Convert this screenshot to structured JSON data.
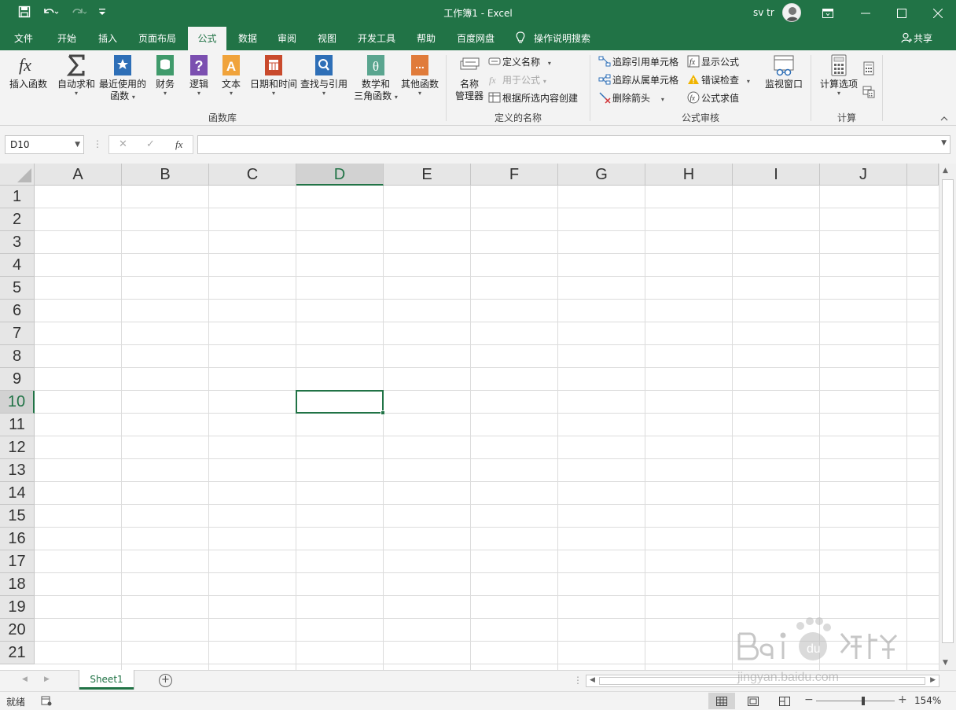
{
  "title_bar": {
    "title": "工作簿1  -  Excel",
    "user": "sv tr",
    "save_icon": "save-icon",
    "undo_icon": "undo-icon",
    "redo_icon": "redo-icon",
    "customize_icon": "customize-qat-icon"
  },
  "tabs": [
    {
      "label": "文件",
      "active": false
    },
    {
      "label": "开始",
      "active": false
    },
    {
      "label": "插入",
      "active": false
    },
    {
      "label": "页面布局",
      "active": false
    },
    {
      "label": "公式",
      "active": true
    },
    {
      "label": "数据",
      "active": false
    },
    {
      "label": "审阅",
      "active": false
    },
    {
      "label": "视图",
      "active": false
    },
    {
      "label": "开发工具",
      "active": false
    },
    {
      "label": "帮助",
      "active": false
    },
    {
      "label": "百度网盘",
      "active": false
    }
  ],
  "tell_me": "操作说明搜索",
  "share": "共享",
  "ribbon": {
    "function_library": {
      "label": "函数库",
      "insert_function": "插入函数",
      "autosum": "自动求和",
      "recent_line1": "最近使用的",
      "recent_line2": "函数",
      "financial": "财务",
      "logical": "逻辑",
      "text": "文本",
      "datetime": "日期和时间",
      "lookup": "查找与引用",
      "math_line1": "数学和",
      "math_line2": "三角函数",
      "more": "其他函数"
    },
    "defined_names": {
      "label": "定义的名称",
      "name_manager_line1": "名称",
      "name_manager_line2": "管理器",
      "define_name": "定义名称",
      "use_in_formula": "用于公式",
      "create_from_selection": "根据所选内容创建"
    },
    "formula_auditing": {
      "label": "公式审核",
      "trace_precedents": "追踪引用单元格",
      "trace_dependents": "追踪从属单元格",
      "remove_arrows": "删除箭头",
      "show_formulas": "显示公式",
      "error_checking": "错误检查",
      "evaluate_formula": "公式求值",
      "watch_window": "监视窗口"
    },
    "calculation": {
      "label": "计算",
      "options": "计算选项"
    }
  },
  "formula_bar": {
    "name_box": "D10",
    "formula": "",
    "fx": "fx",
    "cancel": "✕",
    "enter": "✓"
  },
  "grid": {
    "columns": [
      "A",
      "B",
      "C",
      "D",
      "E",
      "F",
      "G",
      "H",
      "I",
      "J"
    ],
    "rows": [
      "1",
      "2",
      "3",
      "4",
      "5",
      "6",
      "7",
      "8",
      "9",
      "10",
      "11",
      "12",
      "13",
      "14",
      "15",
      "16",
      "17",
      "18",
      "19",
      "20",
      "21"
    ],
    "selected_column": "D",
    "selected_row": "10"
  },
  "sheets": [
    {
      "name": "Sheet1",
      "active": true
    }
  ],
  "status": {
    "text": "就绪",
    "zoom": "154%",
    "zoom_fraction": 0.6
  },
  "accent_color": "#217346"
}
